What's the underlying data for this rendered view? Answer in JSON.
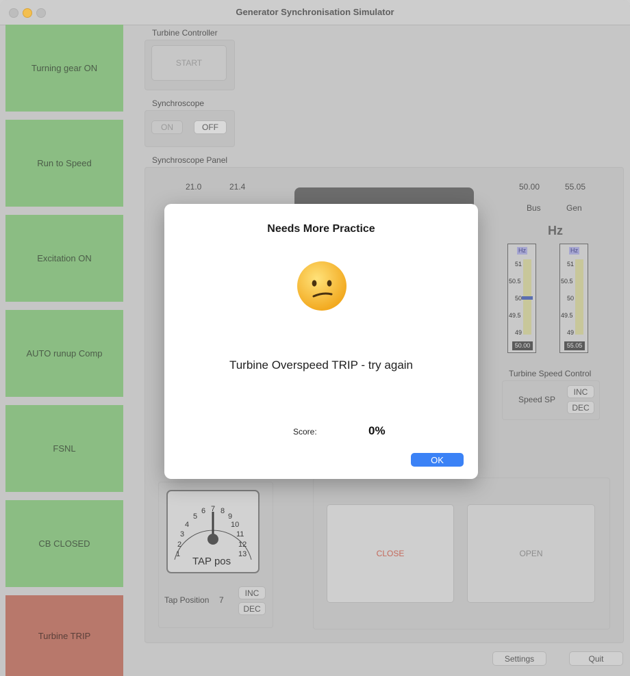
{
  "window": {
    "title": "Generator Synchronisation Simulator"
  },
  "sidebar": {
    "items": [
      {
        "label": "Turning gear ON"
      },
      {
        "label": "Run to Speed"
      },
      {
        "label": "Excitation ON"
      },
      {
        "label": "AUTO runup Comp"
      },
      {
        "label": "FSNL"
      },
      {
        "label": "CB CLOSED"
      },
      {
        "label": "Turbine TRIP"
      }
    ]
  },
  "turbine_controller": {
    "label": "Turbine Controller",
    "start_label": "START"
  },
  "synchroscope": {
    "label": "Synchroscope",
    "on_label": "ON",
    "off_label": "OFF"
  },
  "synchroscope_panel": {
    "label": "Synchroscope Panel",
    "value_left": "21.0",
    "value_right": "21.4",
    "bus_value": "50.00",
    "gen_value": "55.05",
    "bus_label": "Bus",
    "gen_label": "Gen",
    "hz_label": "Hz"
  },
  "meters": {
    "unit": "Hz",
    "ticks": [
      "51",
      "50.5",
      "50",
      "49.5",
      "49"
    ],
    "bus_readout": "50.00",
    "gen_readout": "55.05",
    "bus_level_hz": 50.0
  },
  "speed_control": {
    "label": "Turbine Speed Control",
    "sp_label": "Speed SP",
    "inc_label": "INC",
    "dec_label": "DEC"
  },
  "tap": {
    "gauge_label": "TAP pos",
    "dial_numbers": [
      "1",
      "2",
      "3",
      "4",
      "5",
      "6",
      "7",
      "8",
      "9",
      "10",
      "11",
      "12",
      "13"
    ],
    "position_label": "Tap Position",
    "position_value": "7",
    "inc_label": "INC",
    "dec_label": "DEC"
  },
  "breaker": {
    "close_label": "CLOSE",
    "open_label": "OPEN"
  },
  "footer": {
    "settings_label": "Settings",
    "quit_label": "Quit"
  },
  "dialog": {
    "title": "Needs More Practice",
    "message": "Turbine Overspeed TRIP - try again",
    "score_label": "Score:",
    "score_value": "0%",
    "ok_label": "OK"
  },
  "colors": {
    "step_green": "#8bbd83",
    "step_red": "#b8786b",
    "accent_blue": "#3b82f6",
    "close_red": "#c46a5c"
  }
}
